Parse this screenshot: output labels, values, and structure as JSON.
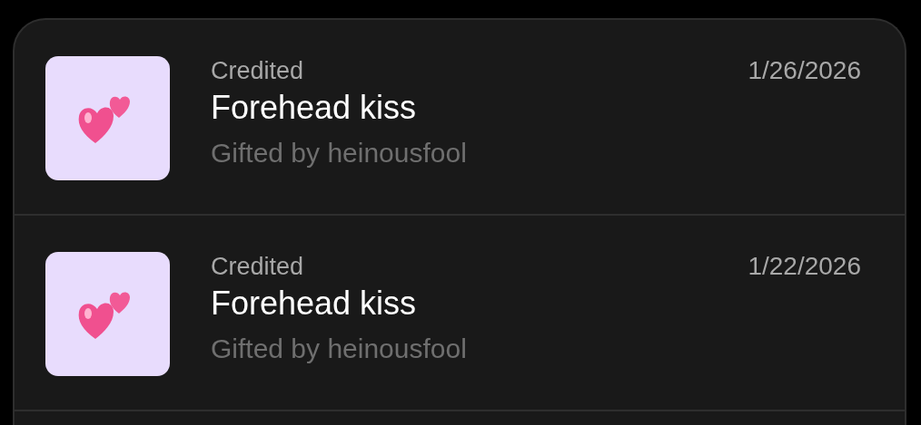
{
  "transactions": [
    {
      "status": "Credited",
      "date": "1/26/2026",
      "title": "Forehead kiss",
      "subtitle": "Gifted by heinousfool"
    },
    {
      "status": "Credited",
      "date": "1/22/2026",
      "title": "Forehead kiss",
      "subtitle": "Gifted by heinousfool"
    }
  ]
}
